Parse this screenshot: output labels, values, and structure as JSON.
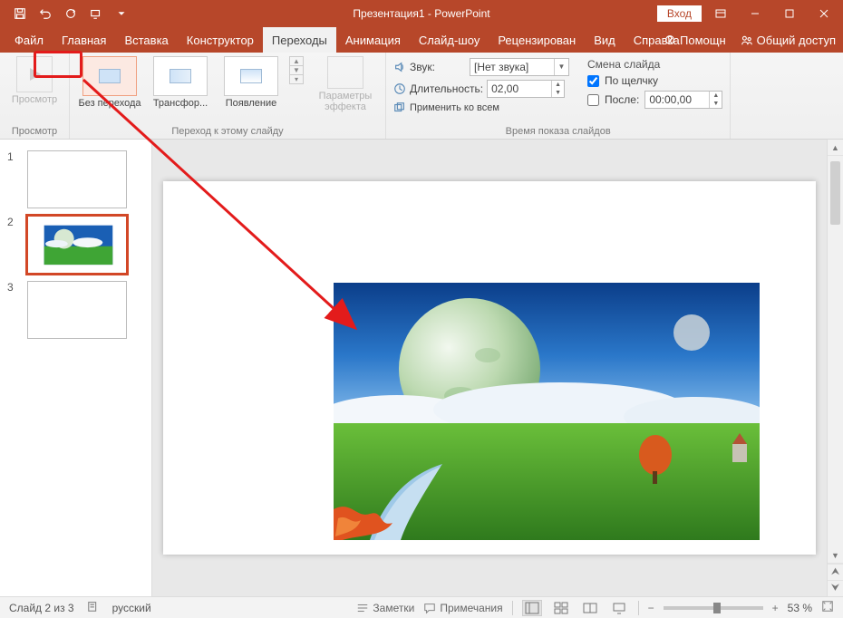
{
  "title": "Презентация1 - PowerPoint",
  "login": "Вход",
  "tabs": {
    "file": "Файл",
    "home": "Главная",
    "insert": "Вставка",
    "design": "Конструктор",
    "transitions": "Переходы",
    "animations": "Анимация",
    "slideshow": "Слайд-шоу",
    "review": "Рецензирован",
    "view": "Вид",
    "help": "Справка",
    "tellme": "Помощн",
    "share": "Общий доступ"
  },
  "ribbon": {
    "preview_label": "Просмотр",
    "preview_group": "Просмотр",
    "gallery": {
      "none": "Без перехода",
      "morph": "Трансфор...",
      "fade": "Появление"
    },
    "effect_options": "Параметры эффекта",
    "transition_group": "Переход к этому слайду",
    "sound_label": "Звук:",
    "sound_value": "[Нет звука]",
    "duration_label": "Длительность:",
    "duration_value": "02,00",
    "apply_all": "Применить ко всем",
    "advance_title": "Смена слайда",
    "on_click": "По щелчку",
    "after_label": "После:",
    "after_value": "00:00,00",
    "timing_group": "Время показа слайдов"
  },
  "thumbs": {
    "n1": "1",
    "n2": "2",
    "n3": "3"
  },
  "status": {
    "slide_of": "Слайд 2 из 3",
    "language": "русский",
    "notes": "Заметки",
    "comments": "Примечания",
    "zoom_pct": "53 %"
  }
}
